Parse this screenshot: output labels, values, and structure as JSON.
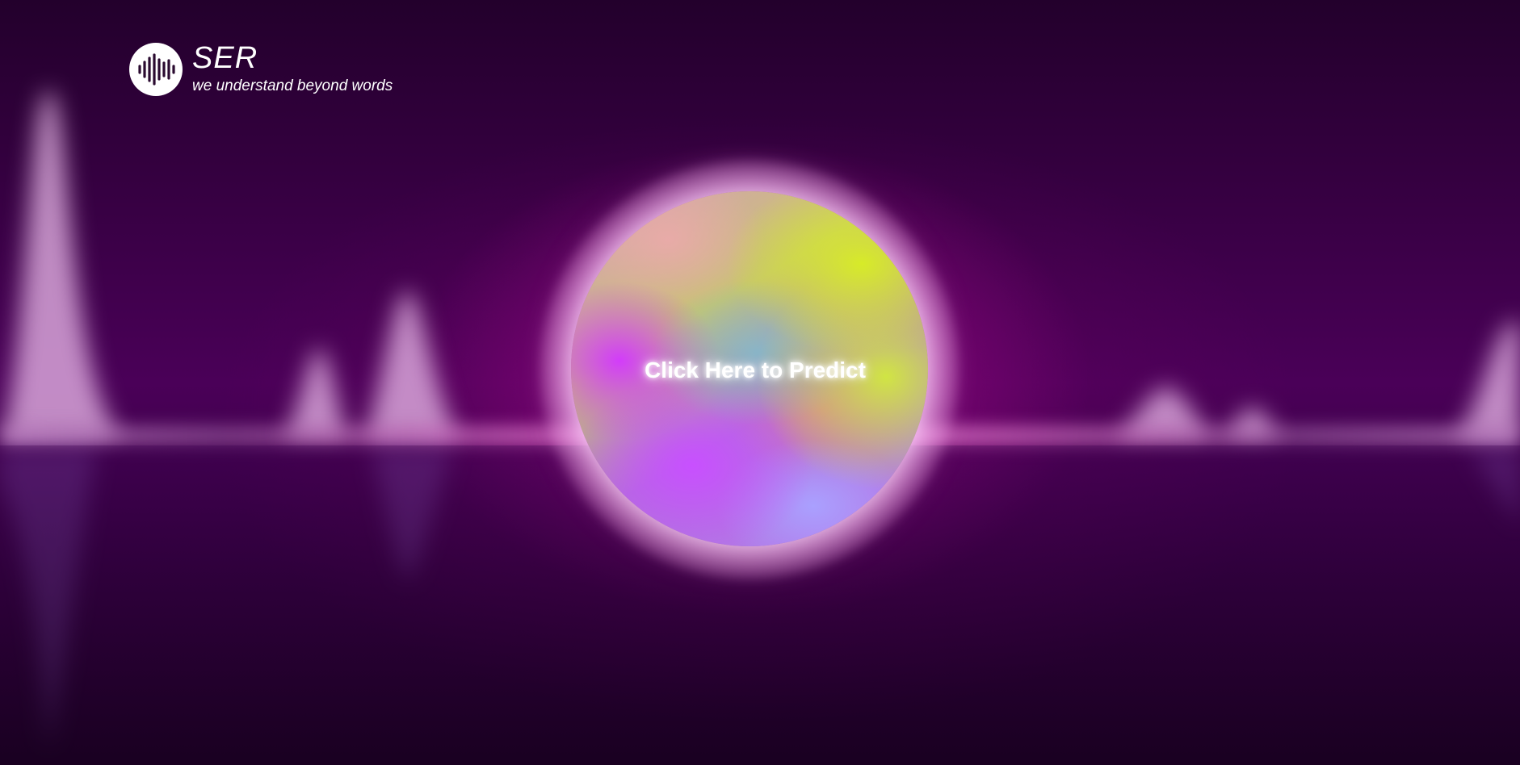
{
  "brand": {
    "title": "SER",
    "tagline": "we understand beyond words",
    "logo_icon": "soundwave-icon"
  },
  "predict": {
    "label": "Click Here to Predict"
  },
  "colors": {
    "background_dark": "#23002c",
    "background_mid": "#4a0058",
    "glow_pink": "#ff96e6",
    "orb_yellow": "#d7eb28",
    "orb_purple": "#c83cfa",
    "orb_lavender": "#aaa0ff",
    "text": "#ffffff"
  }
}
